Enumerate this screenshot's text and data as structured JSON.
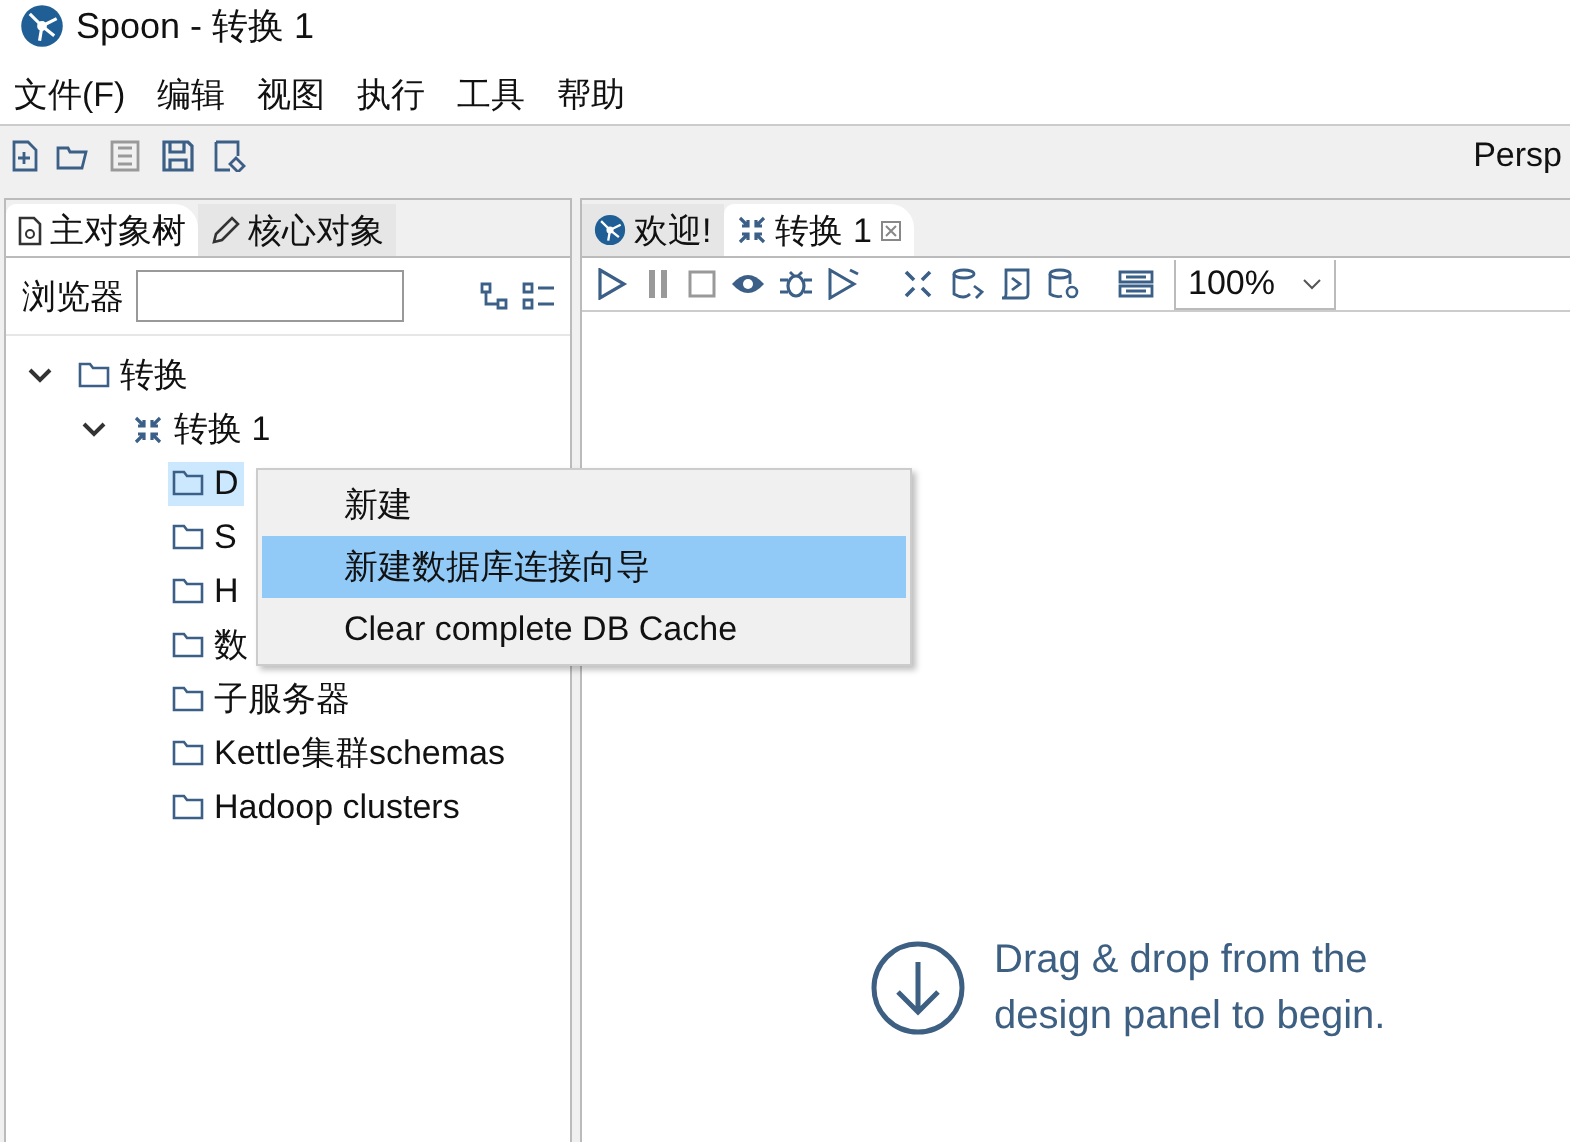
{
  "window": {
    "title": "Spoon - 转换 1"
  },
  "menu": [
    "文件(F)",
    "编辑",
    "视图",
    "执行",
    "工具",
    "帮助"
  ],
  "toolbar": {
    "perspective_label": "Persp"
  },
  "left_tabs": [
    {
      "label": "主对象树",
      "kind": "tree",
      "selected": true
    },
    {
      "label": "核心对象",
      "kind": "pencil",
      "selected": false
    }
  ],
  "browser": {
    "label": "浏览器"
  },
  "tree": [
    {
      "label": "转换",
      "kind": "folder",
      "expanded": true,
      "selected": false,
      "children": [
        {
          "label": "转换 1",
          "kind": "transform",
          "expanded": true,
          "selected": false,
          "children": [
            {
              "label": "D",
              "kind": "folder",
              "selected": true
            },
            {
              "label": "S",
              "kind": "folder",
              "selected": false
            },
            {
              "label": "H",
              "kind": "folder",
              "selected": false
            },
            {
              "label": "数",
              "kind": "folder",
              "selected": false
            },
            {
              "label": "子服务器",
              "kind": "folder",
              "selected": false
            },
            {
              "label": "Kettle集群schemas",
              "kind": "folder",
              "selected": false
            },
            {
              "label": "Hadoop clusters",
              "kind": "folder",
              "selected": false
            }
          ]
        }
      ]
    }
  ],
  "editor_tabs": [
    {
      "label": "欢迎!",
      "kind": "welcome",
      "selected": false,
      "closable": false
    },
    {
      "label": "转换 1",
      "kind": "transform",
      "selected": true,
      "closable": true
    }
  ],
  "zoom": "100%",
  "context_menu": [
    {
      "label": "新建",
      "selected": false
    },
    {
      "label": "新建数据库连接向导",
      "selected": true
    },
    {
      "label": "Clear complete DB Cache",
      "selected": false
    }
  ],
  "hint": [
    "Drag & drop from the",
    "design panel to begin."
  ]
}
